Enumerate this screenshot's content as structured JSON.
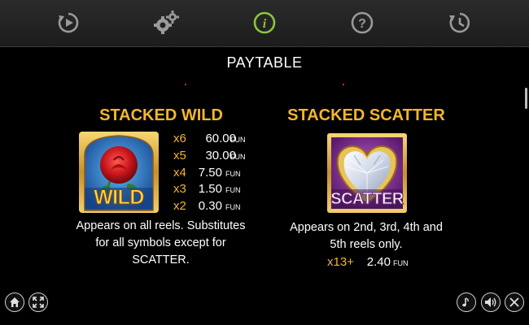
{
  "nav": {
    "items": [
      {
        "name": "autoplay-icon"
      },
      {
        "name": "settings-icon"
      },
      {
        "name": "info-icon",
        "active": true
      },
      {
        "name": "help-icon"
      },
      {
        "name": "history-icon"
      }
    ],
    "colors": {
      "default": "#9a9a9a",
      "active": "#8cc63f"
    }
  },
  "page": {
    "title": "PAYTABLE"
  },
  "wild": {
    "heading": "STACKED WILD",
    "symbol_label": "WILD",
    "payouts": [
      {
        "mult": "x6",
        "amount": "60.00",
        "unit": "FUN"
      },
      {
        "mult": "x5",
        "amount": "30.00",
        "unit": "FUN"
      },
      {
        "mult": "x4",
        "amount": "7.50",
        "unit": "FUN"
      },
      {
        "mult": "x3",
        "amount": "1.50",
        "unit": "FUN"
      },
      {
        "mult": "x2",
        "amount": "0.30",
        "unit": "FUN"
      }
    ],
    "description_lines": [
      "Appears on all reels. Substitutes",
      "for all symbols except for",
      "SCATTER."
    ]
  },
  "scatter": {
    "heading": "STACKED SCATTER",
    "symbol_label": "SCATTER",
    "description_lines": [
      "Appears on 2nd, 3rd, 4th and",
      "5th reels only."
    ],
    "payout": {
      "mult": "x13+",
      "amount": "2.40",
      "unit": "FUN"
    }
  },
  "bottom_left": [
    {
      "name": "home-icon"
    },
    {
      "name": "fullscreen-icon"
    }
  ],
  "bottom_right": [
    {
      "name": "music-icon"
    },
    {
      "name": "sound-icon"
    },
    {
      "name": "close-icon"
    }
  ],
  "accent_color": "#f5b62a"
}
